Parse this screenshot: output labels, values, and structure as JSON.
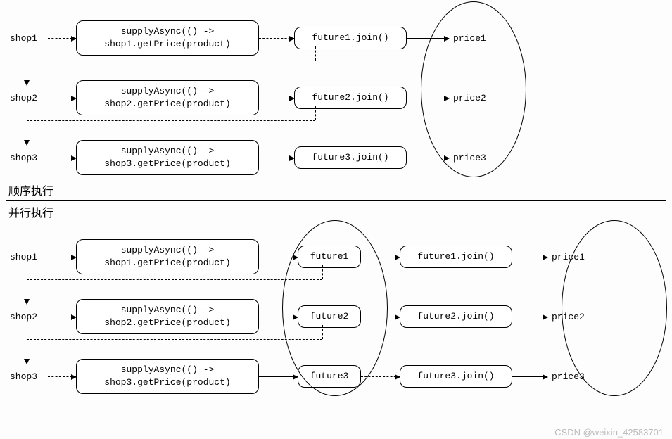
{
  "top": {
    "rows": [
      {
        "shop": "shop1",
        "code_l1": "supplyAsync(() ->",
        "code_l2": "shop1.getPrice(product)",
        "join": "future1.join()",
        "price": "price1"
      },
      {
        "shop": "shop2",
        "code_l1": "supplyAsync(() ->",
        "code_l2": "shop2.getPrice(product)",
        "join": "future2.join()",
        "price": "price2"
      },
      {
        "shop": "shop3",
        "code_l1": "supplyAsync(() ->",
        "code_l2": "shop3.getPrice(product)",
        "join": "future3.join()",
        "price": "price3"
      }
    ],
    "caption": "顺序执行"
  },
  "bottom": {
    "caption": "并行执行",
    "rows": [
      {
        "shop": "shop1",
        "code_l1": "supplyAsync(() ->",
        "code_l2": "shop1.getPrice(product)",
        "future": "future1",
        "join": "future1.join()",
        "price": "price1"
      },
      {
        "shop": "shop2",
        "code_l1": "supplyAsync(() ->",
        "code_l2": "shop2.getPrice(product)",
        "future": "future2",
        "join": "future2.join()",
        "price": "price2"
      },
      {
        "shop": "shop3",
        "code_l1": "supplyAsync(() ->",
        "code_l2": "shop3.getPrice(product)",
        "future": "future3",
        "join": "future3.join()",
        "price": "price3"
      }
    ]
  },
  "watermark": "CSDN @weixin_42583701"
}
